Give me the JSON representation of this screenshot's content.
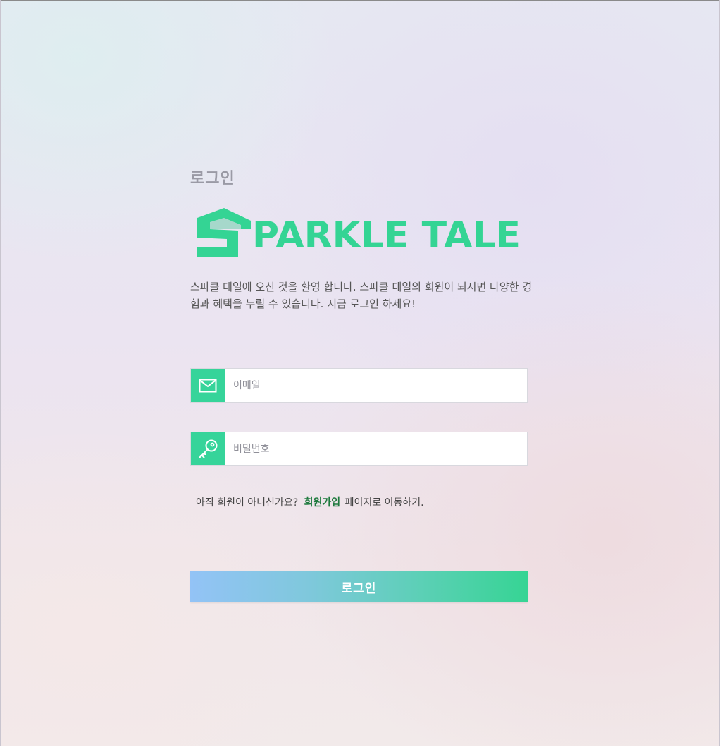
{
  "page": {
    "title": "로그인"
  },
  "logo": {
    "text": "PARKLE TALE",
    "mark_letter": "S",
    "color": "#34d494"
  },
  "welcome_text": "스파클 테일에 오신 것을 환영 합니다. 스파클 테일의 회원이 되시면 다양한 경험과 혜택을 누릴 수 있습니다. 지금 로그인 하세요!",
  "form": {
    "email": {
      "placeholder": "이메일",
      "value": "",
      "icon": "envelope-icon"
    },
    "password": {
      "placeholder": "비밀번호",
      "value": "",
      "icon": "key-icon"
    }
  },
  "signup": {
    "prefix": "아직 회원이 아니신가요?",
    "link_label": "회원가입",
    "suffix": "페이지로 이동하기."
  },
  "login_button": {
    "label": "로그인",
    "gradient_start": "#93c3f6",
    "gradient_end": "#36d494"
  },
  "colors": {
    "accent": "#36d49a",
    "link": "#1e7a3e"
  }
}
